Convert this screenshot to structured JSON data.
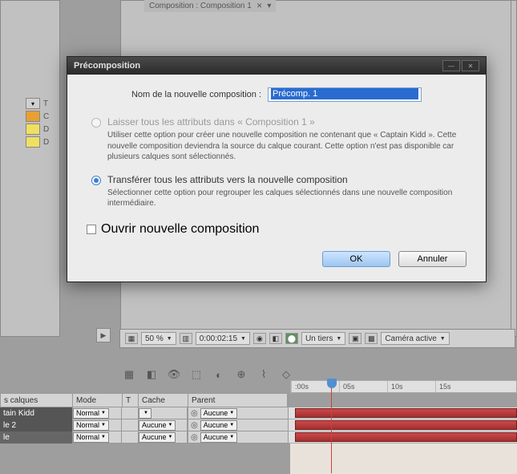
{
  "top_tab": {
    "label": "Composition : Composition 1"
  },
  "left_items": [
    {
      "label": "T"
    },
    {
      "label": "C"
    },
    {
      "label": "D"
    },
    {
      "label": "D"
    }
  ],
  "dialog": {
    "title": "Précomposition",
    "field_label": "Nom de la nouvelle composition :",
    "field_value": "Précomp. 1",
    "option1": {
      "label": "Laisser tous les attributs dans « Composition 1 »",
      "desc": "Utiliser cette option pour créer une nouvelle composition ne contenant que « Captain Kidd ». Cette nouvelle composition deviendra la source du calque courant. Cette option n'est pas disponible car plusieurs calques sont sélectionnés."
    },
    "option2": {
      "label": "Transférer tous les attributs vers la nouvelle composition",
      "desc": "Sélectionner cette option pour regrouper les calques sélectionnés dans une nouvelle composition intermédiaire."
    },
    "open_new": "Ouvrir nouvelle composition",
    "ok": "OK",
    "cancel": "Annuler"
  },
  "footer": {
    "zoom": "50 %",
    "timecode": "0:00:02:15",
    "quality": "Un tiers",
    "camera": "Caméra active"
  },
  "columns": {
    "calques": "s calques",
    "mode": "Mode",
    "t": "T",
    "cache": "Cache",
    "parent": "Parent"
  },
  "layers": [
    {
      "name": "tain Kidd",
      "mode": "Normal",
      "cache": "",
      "parent": "Aucune"
    },
    {
      "name": "le 2",
      "mode": "Normal",
      "cache": "Aucune",
      "parent": "Aucune"
    },
    {
      "name": "le",
      "mode": "Normal",
      "cache": "Aucune",
      "parent": "Aucune"
    }
  ],
  "timeline": {
    "ticks": [
      ":00s",
      "05s",
      "10s",
      "15s"
    ]
  }
}
